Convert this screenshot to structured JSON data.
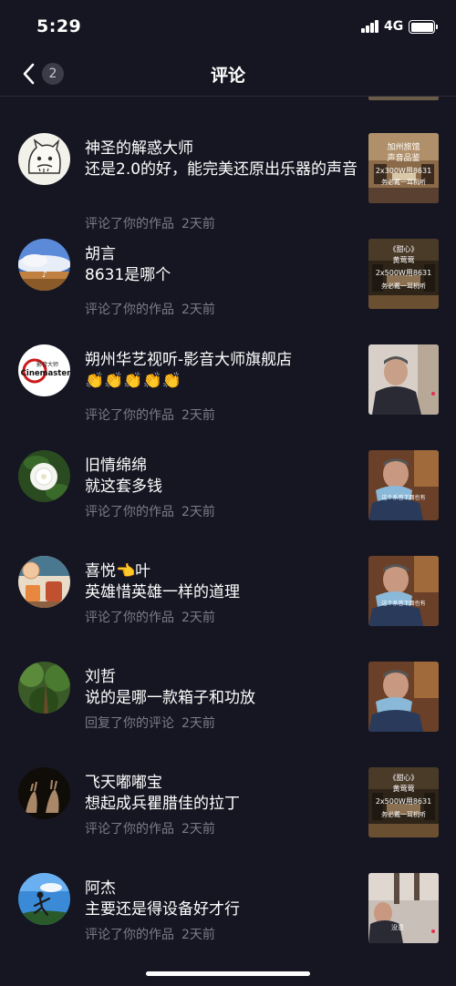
{
  "status_bar": {
    "time": "5:29",
    "network": "4G",
    "battery_level": 1.0
  },
  "nav": {
    "title": "评论",
    "back_icon": "chevron-left-icon",
    "count": "2"
  },
  "comments": [
    {
      "name": "神圣的解惑大师",
      "text": "还是2.0的好，能完美还原出乐器的声音",
      "action": "评论了你的作品",
      "time": "2天前",
      "thumb_text": [
        "加州旅馆",
        "声音品鉴",
        "2x300W用8631",
        "务必戴一耳机听"
      ]
    },
    {
      "name": "胡言",
      "text": "8631是哪个",
      "action": "评论了你的作品",
      "time": "2天前",
      "thumb_text": [
        "《甜心》",
        "黄莺莺",
        "2x500W用8631",
        "务必戴一耳机听"
      ]
    },
    {
      "name": "朔州华艺视听-影音大师旗舰店",
      "text": "👏👏👏👏👏",
      "action": "评论了你的作品",
      "time": "2天前",
      "avatar_text": [
        "影音大师",
        "Cinemaster"
      ]
    },
    {
      "name": "旧情绵绵",
      "text": "就这套多钱",
      "action": "评论了你的作品",
      "time": "2天前",
      "thumb_text": [
        "这个系音下面也有"
      ]
    },
    {
      "name": "喜悦👈叶",
      "text": "英雄惜英雄一样的道理",
      "action": "评论了你的作品",
      "time": "2天前",
      "thumb_text": [
        "这个系音下面也有"
      ]
    },
    {
      "name": "刘哲",
      "text": "说的是哪一款箱子和功放",
      "action": "回复了你的评论",
      "time": "2天前"
    },
    {
      "name": "飞天嘟嘟宝",
      "text": "想起成兵瞿腊佳的拉丁",
      "action": "评论了你的作品",
      "time": "2天前",
      "thumb_text": [
        "《甜心》",
        "黄莺莺",
        "2x500W用8631",
        "务必戴一耳机听"
      ]
    },
    {
      "name": "阿杰",
      "text": "主要还是得设备好才行",
      "action": "评论了你的作品",
      "time": "2天前",
      "thumb_text": [
        "没意"
      ]
    }
  ]
}
